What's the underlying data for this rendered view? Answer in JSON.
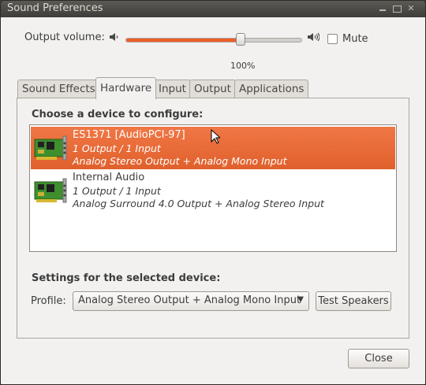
{
  "window": {
    "title": "Sound Preferences"
  },
  "volume": {
    "label": "Output volume:",
    "level_percent": 100,
    "value_text": "100%",
    "slider_fill_fraction": 0.66,
    "mute_label": "Mute",
    "muted": false
  },
  "tabs": [
    {
      "label": "Sound Effects",
      "active": false
    },
    {
      "label": "Hardware",
      "active": true
    },
    {
      "label": "Input",
      "active": false
    },
    {
      "label": "Output",
      "active": false
    },
    {
      "label": "Applications",
      "active": false
    }
  ],
  "hardware": {
    "choose_heading": "Choose a device to configure:",
    "devices": [
      {
        "name": "ES1371 [AudioPCI-97]",
        "ports": "1 Output / 1 Input",
        "profile": "Analog Stereo Output + Analog Mono Input",
        "selected": true,
        "icon": "sound-card-icon"
      },
      {
        "name": "Internal Audio",
        "ports": "1 Output / 1 Input",
        "profile": "Analog Surround 4.0 Output + Analog Stereo Input",
        "selected": false,
        "icon": "sound-card-icon"
      }
    ],
    "settings_heading": "Settings for the selected device:",
    "profile_label": "Profile:",
    "profile_value": "Analog Stereo Output + Analog Mono Input",
    "test_speakers_label": "Test Speakers"
  },
  "footer": {
    "close_label": "Close"
  },
  "colors": {
    "accent": "#ef5e28",
    "selection": "#e8693a",
    "window_bg": "#f2f1f0",
    "titlebar": "#4a4944"
  },
  "icons": {
    "volume_low": "speaker-low-icon",
    "volume_high": "speaker-high-icon",
    "card": "sound-card-icon",
    "cursor": "mouse-pointer-icon"
  }
}
